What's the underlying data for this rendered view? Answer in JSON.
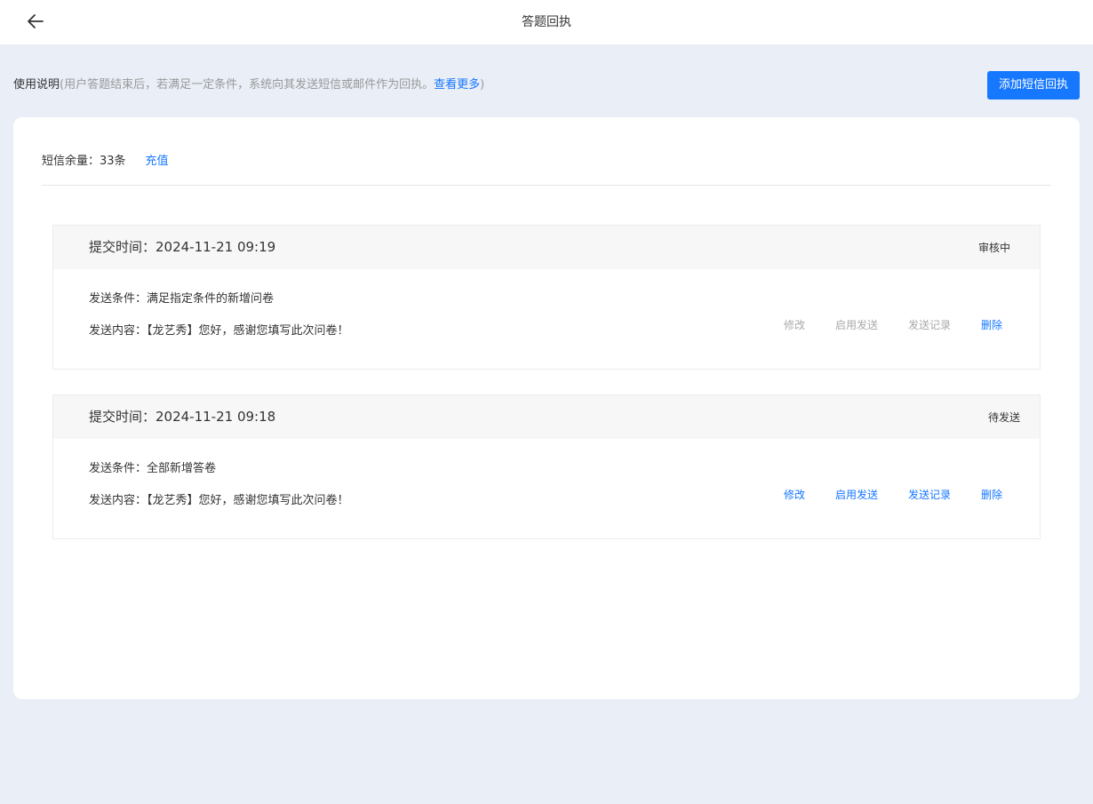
{
  "header": {
    "title": "答题回执"
  },
  "usage": {
    "label": "使用说明",
    "description": "(用户答题结束后，若满足一定条件，系统向其发送短信或邮件作为回执。",
    "link": "查看更多",
    "close_paren": ")"
  },
  "toolbar": {
    "add_label": "添加短信回执"
  },
  "balance": {
    "text": "短信余量：33条",
    "recharge_label": "充值"
  },
  "receipts": [
    {
      "submit_time": "提交时间：2024-11-21 09:19",
      "status": "审核中",
      "condition": "发送条件：满足指定条件的新增问卷",
      "content": "发送内容：【龙艺秀】您好，感谢您填写此次问卷！",
      "actions": {
        "edit": "修改",
        "enable": "启用发送",
        "log": "发送记录",
        "delete": "删除"
      }
    },
    {
      "submit_time": "提交时间：2024-11-21 09:18",
      "status": "待发送",
      "condition": "发送条件：全部新增答卷",
      "content": "发送内容：【龙艺秀】您好，感谢您填写此次问卷！",
      "actions": {
        "edit": "修改",
        "enable": "启用发送",
        "log": "发送记录",
        "delete": "删除"
      }
    }
  ],
  "colors": {
    "accent": "#1677ff",
    "background": "#e9eef7",
    "disabled": "#a9a9a9"
  },
  "icons": {
    "back": "arrow-left-icon"
  }
}
